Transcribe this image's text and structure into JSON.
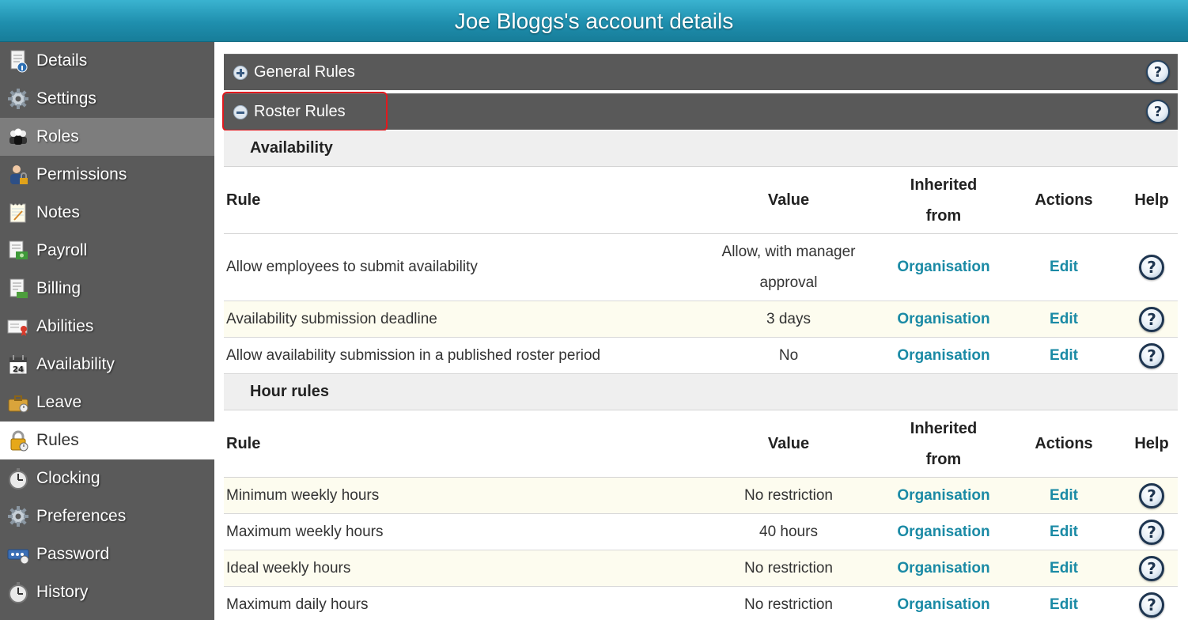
{
  "window": {
    "title": "Joe Bloggs's account details"
  },
  "sidebar": {
    "items": [
      {
        "label": "Details",
        "icon": "document-info-icon"
      },
      {
        "label": "Settings",
        "icon": "gear-icon"
      },
      {
        "label": "Roles",
        "icon": "people-icon"
      },
      {
        "label": "Permissions",
        "icon": "user-lock-icon"
      },
      {
        "label": "Notes",
        "icon": "notepad-icon"
      },
      {
        "label": "Payroll",
        "icon": "money-document-icon"
      },
      {
        "label": "Billing",
        "icon": "invoice-icon"
      },
      {
        "label": "Abilities",
        "icon": "certificate-icon"
      },
      {
        "label": "Availability",
        "icon": "calendar-icon"
      },
      {
        "label": "Leave",
        "icon": "suitcase-icon"
      },
      {
        "label": "Rules",
        "icon": "padlock-icon"
      },
      {
        "label": "Clocking",
        "icon": "stopwatch-icon"
      },
      {
        "label": "Preferences",
        "icon": "gear-icon"
      },
      {
        "label": "Password",
        "icon": "password-field-icon"
      },
      {
        "label": "History",
        "icon": "stopwatch-icon"
      }
    ],
    "active": "Rules",
    "hovered": "Roles"
  },
  "sections": {
    "general": {
      "label": "General Rules",
      "state": "collapsed"
    },
    "roster": {
      "label": "Roster Rules",
      "state": "expanded"
    }
  },
  "columns": {
    "rule": "Rule",
    "value": "Value",
    "inherited": "Inherited from",
    "actions": "Actions",
    "help": "Help"
  },
  "groups": [
    {
      "title": "Availability",
      "rows": [
        {
          "rule": "Allow employees to submit availability",
          "value": "Allow, with manager approval",
          "inherited": "Organisation",
          "action": "Edit"
        },
        {
          "rule": "Availability submission deadline",
          "value": "3 days",
          "inherited": "Organisation",
          "action": "Edit"
        },
        {
          "rule": "Allow availability submission in a published roster period",
          "value": "No",
          "inherited": "Organisation",
          "action": "Edit"
        }
      ]
    },
    {
      "title": "Hour rules",
      "rows": [
        {
          "rule": "Minimum weekly hours",
          "value": "No restriction",
          "inherited": "Organisation",
          "action": "Edit"
        },
        {
          "rule": "Maximum weekly hours",
          "value": "40 hours",
          "inherited": "Organisation",
          "action": "Edit"
        },
        {
          "rule": "Ideal weekly hours",
          "value": "No restriction",
          "inherited": "Organisation",
          "action": "Edit"
        },
        {
          "rule": "Maximum daily hours",
          "value": "No restriction",
          "inherited": "Organisation",
          "action": "Edit"
        }
      ]
    }
  ],
  "help_glyph": "?",
  "colors": {
    "title_bar": "#2a9fbd",
    "sidebar": "#5a5a5a",
    "section_bar": "#595959",
    "link": "#1a8aa5",
    "highlight": "#e0191e"
  }
}
